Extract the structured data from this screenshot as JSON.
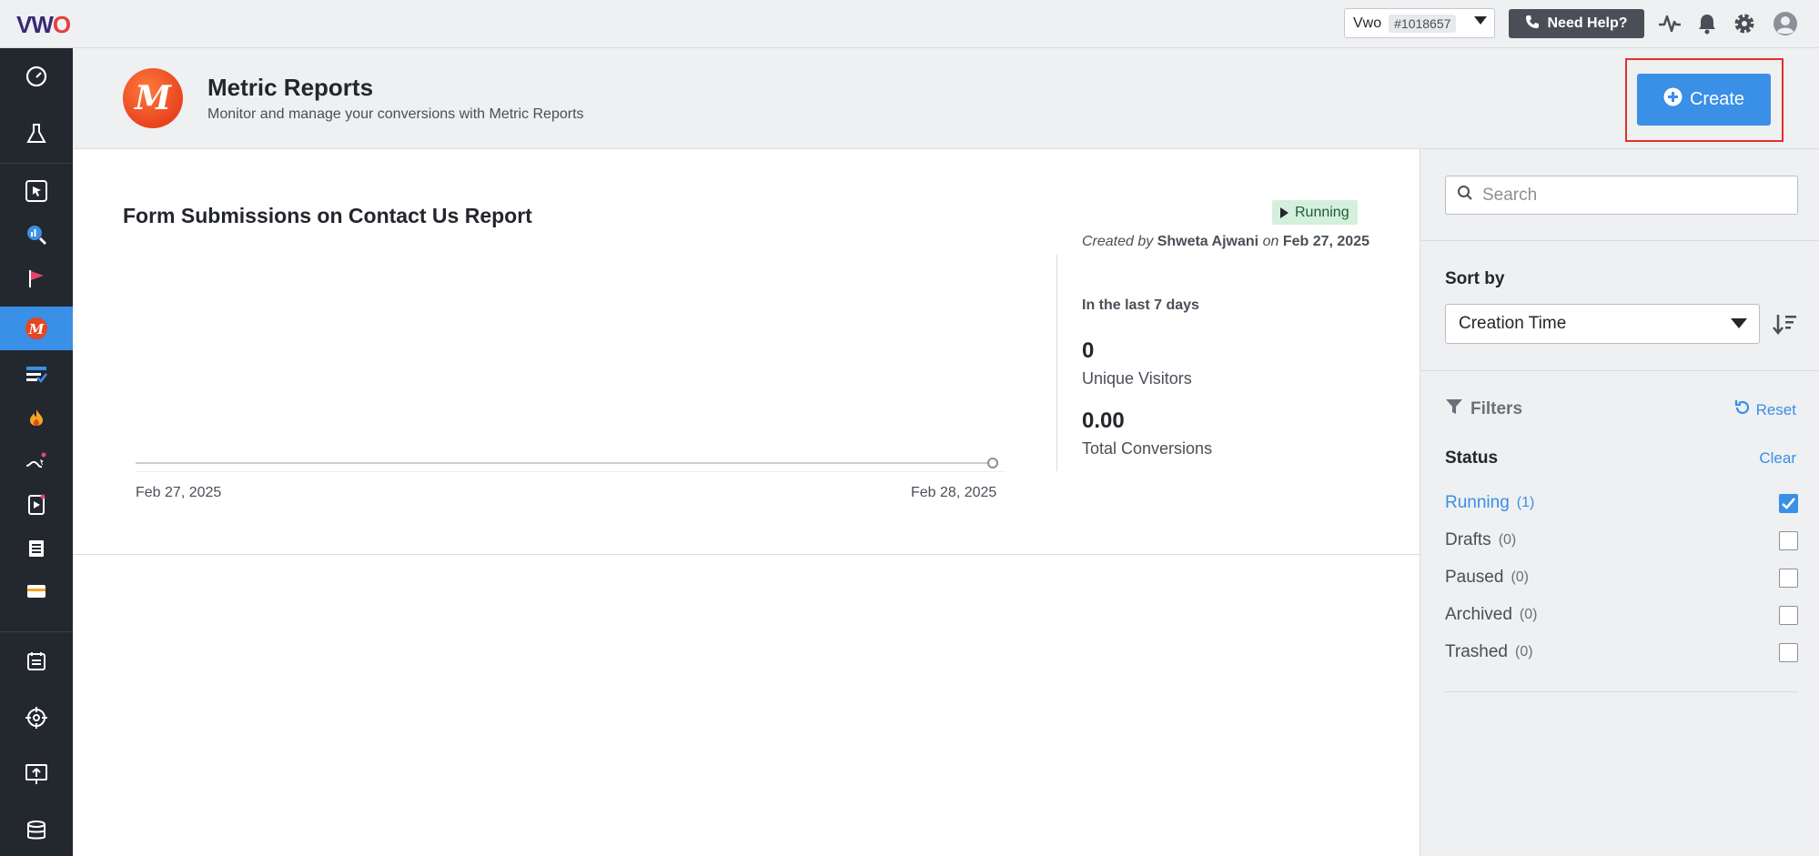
{
  "topbar": {
    "logo_part1": "VW",
    "logo_part2": "O",
    "account_name": "Vwo",
    "account_id": "#1018657",
    "help_label": "Need Help?",
    "icons": [
      "activity-icon",
      "bell-icon",
      "gear-icon",
      "user-avatar-icon"
    ]
  },
  "sidebar": {
    "items": [
      {
        "icon": "dashboard-icon"
      },
      {
        "icon": "testing-flask-icon"
      },
      {
        "icon": "insights-cursor-icon"
      },
      {
        "icon": "analytics-icon"
      },
      {
        "icon": "flag-icon"
      },
      {
        "icon": "metric-reports-icon",
        "active": true
      },
      {
        "icon": "survey-icon"
      },
      {
        "icon": "fire-icon"
      },
      {
        "icon": "funnel-icon"
      },
      {
        "icon": "recording-icon"
      },
      {
        "icon": "form-icon"
      },
      {
        "icon": "card-icon"
      },
      {
        "icon": "clipboard-icon"
      },
      {
        "icon": "crosshair-icon"
      },
      {
        "icon": "deploy-icon"
      },
      {
        "icon": "database-icon"
      }
    ]
  },
  "header": {
    "logo_letter": "M",
    "title": "Metric Reports",
    "subtitle": "Monitor and manage your conversions with Metric Reports",
    "create_label": "Create"
  },
  "report": {
    "title": "Form Submissions on Contact Us Report",
    "status": "Running",
    "created_prefix": "Created by",
    "created_by": "Shweta Ajwani",
    "created_on_word": "on",
    "created_date": "Feb 27, 2025",
    "chart": {
      "x_start": "Feb 27, 2025",
      "x_end": "Feb 28, 2025"
    },
    "stats": {
      "period": "In the last 7 days",
      "visitors_value": "0",
      "visitors_label": "Unique Visitors",
      "conversions_value": "0.00",
      "conversions_label": "Total Conversions"
    }
  },
  "panel": {
    "search_placeholder": "Search",
    "sort_label": "Sort by",
    "sort_value": "Creation Time",
    "filters_label": "Filters",
    "reset_label": "Reset",
    "status_label": "Status",
    "clear_label": "Clear",
    "statuses": [
      {
        "name": "Running",
        "count": "(1)",
        "checked": true
      },
      {
        "name": "Drafts",
        "count": "(0)",
        "checked": false
      },
      {
        "name": "Paused",
        "count": "(0)",
        "checked": false
      },
      {
        "name": "Archived",
        "count": "(0)",
        "checked": false
      },
      {
        "name": "Trashed",
        "count": "(0)",
        "checked": false
      }
    ]
  },
  "colors": {
    "accent": "#3a8fe6",
    "sidebar_bg": "#23272e",
    "running_badge_bg": "#d4f0dd",
    "highlight_border": "#e4302a"
  }
}
